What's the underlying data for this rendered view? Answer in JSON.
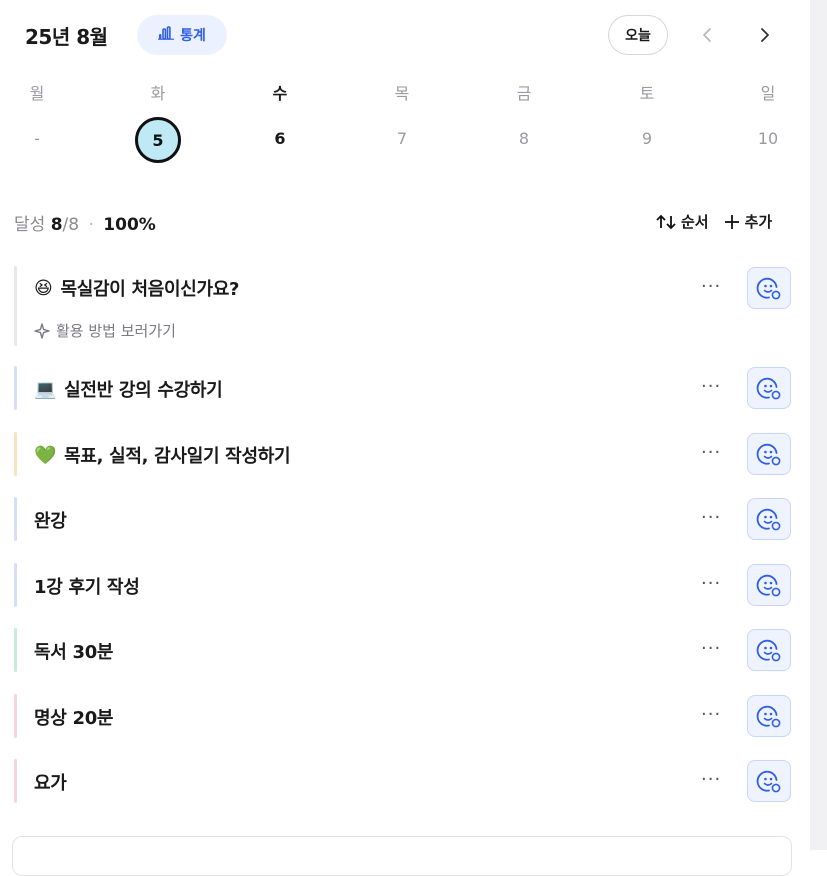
{
  "header": {
    "month_title": "25년 8월",
    "stats_label": "통계",
    "today_label": "오늘"
  },
  "week": {
    "days": [
      {
        "weekday": "월",
        "date": "-"
      },
      {
        "weekday": "화",
        "date": "5"
      },
      {
        "weekday": "수",
        "date": "6"
      },
      {
        "weekday": "목",
        "date": "7"
      },
      {
        "weekday": "금",
        "date": "8"
      },
      {
        "weekday": "토",
        "date": "9"
      },
      {
        "weekday": "일",
        "date": "10"
      }
    ]
  },
  "summary": {
    "label": "달성",
    "done": "8",
    "total": "/8",
    "separator": "·",
    "percent": "100%",
    "sort_label": "순서",
    "add_label": "추가"
  },
  "tasks": [
    {
      "emoji": "😆",
      "title": "목실감이 처음이신가요?",
      "sub": "활용 방법 보러가기",
      "bar_color": "#e8e8ec"
    },
    {
      "emoji": "💻",
      "title": "실전반 강의 수강하기",
      "bar_color": "#d9def7"
    },
    {
      "emoji": "💚",
      "title": "목표, 실적, 감사일기 작성하기",
      "bar_color": "#fbe3c2"
    },
    {
      "title": "완강",
      "bar_color": "#d9def7"
    },
    {
      "title": "1강 후기 작성",
      "bar_color": "#d9def7"
    },
    {
      "title": "독서 30분",
      "bar_color": "#c9ecd9"
    },
    {
      "title": "명상 20분",
      "bar_color": "#f7d3e3"
    },
    {
      "title": "요가",
      "bar_color": "#f7d3e3"
    }
  ],
  "more_label": "···",
  "colors": {
    "accent": "#2f5fe6",
    "selected_day_fill": "#bfe9f5"
  },
  "icons": {
    "stats": "bar-chart-icon",
    "prev": "chevron-left-icon",
    "next": "chevron-right-icon",
    "sort": "sort-arrows-icon",
    "add": "plus-icon",
    "react": "smiley-add-icon",
    "guide": "sparkle-icon"
  }
}
